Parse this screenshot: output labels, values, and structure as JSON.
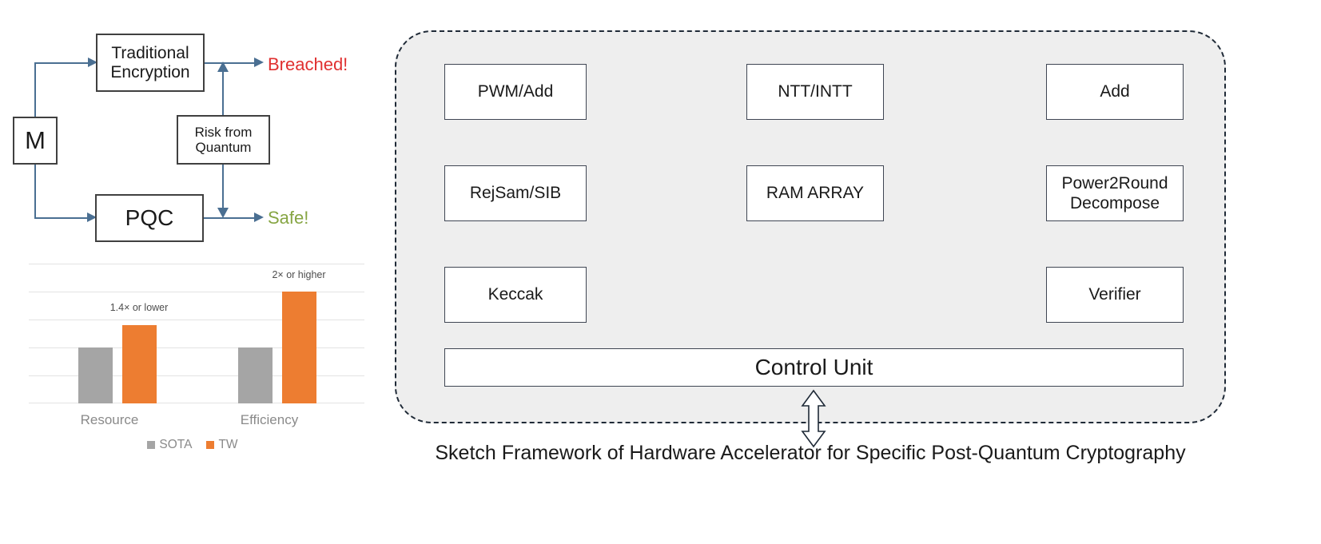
{
  "flow_diagram": {
    "nodes": {
      "message": "M",
      "traditional": "Traditional Encryption",
      "risk": "Risk from Quantum",
      "pqc": "PQC"
    },
    "outcomes": {
      "breached": "Breached!",
      "safe": "Safe!"
    },
    "colors": {
      "breached": "#e03030",
      "safe": "#86a543",
      "arrow": "#4a6f92",
      "box_border": "#404040"
    }
  },
  "chart_data": {
    "type": "bar",
    "title": "",
    "xlabel": "",
    "ylabel": "",
    "categories": [
      "Resource",
      "Efficiency"
    ],
    "series": [
      {
        "name": "SOTA",
        "color": "#a5a5a5",
        "values": [
          2,
          2
        ]
      },
      {
        "name": "TW",
        "color": "#ed7d31",
        "values": [
          2.8,
          4.0
        ]
      }
    ],
    "ylim": [
      0,
      5
    ],
    "grid": true,
    "gridlines": [
      1,
      2,
      3,
      4,
      5
    ],
    "legend_position": "bottom",
    "annotations": [
      {
        "label": "1.4× or lower",
        "category": "Resource",
        "series": "TW"
      },
      {
        "label": "2× or higher",
        "category": "Efficiency",
        "series": "TW"
      }
    ]
  },
  "accelerator": {
    "caption": "Sketch Framework of Hardware Accelerator for Specific Post-Quantum Cryptography",
    "units": [
      {
        "id": "pwm-add",
        "label": "PWM/Add"
      },
      {
        "id": "ntt-intt",
        "label": "NTT/INTT"
      },
      {
        "id": "add",
        "label": "Add"
      },
      {
        "id": "rejsam-sib",
        "label": "RejSam/SIB"
      },
      {
        "id": "ram-array",
        "label": "RAM ARRAY"
      },
      {
        "id": "power2round",
        "label": "Power2Round Decompose"
      },
      {
        "id": "keccak",
        "label": "Keccak"
      },
      {
        "id": "verifier",
        "label": "Verifier"
      }
    ],
    "control_unit": "Control Unit",
    "colors": {
      "frame_fill": "#eeeeee",
      "frame_border": "#1f2a37",
      "unit_border": "#3f4653"
    }
  }
}
